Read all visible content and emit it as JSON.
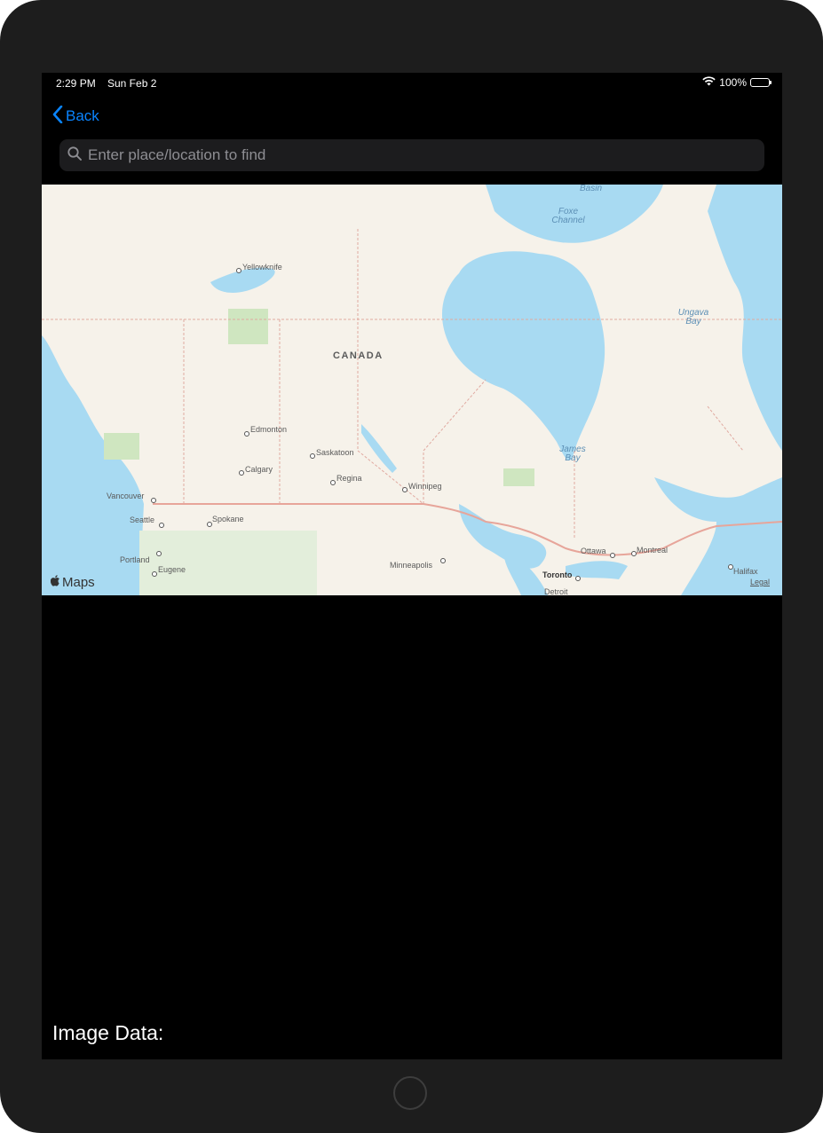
{
  "status_bar": {
    "time": "2:29 PM",
    "date": "Sun Feb 2",
    "battery": "100%",
    "battery_level": 1.0
  },
  "nav": {
    "back_label": "Back"
  },
  "search": {
    "placeholder": "Enter place/location to find",
    "value": ""
  },
  "map": {
    "country_label": "CANADA",
    "water_labels": {
      "basin": "Basin",
      "foxe_channel": "Foxe Channel",
      "ungava_bay": "Ungava Bay",
      "james_bay": "James Bay"
    },
    "cities": {
      "yellowknife": "Yellowknife",
      "edmonton": "Edmonton",
      "saskatoon": "Saskatoon",
      "calgary": "Calgary",
      "regina": "Regina",
      "winnipeg": "Winnipeg",
      "vancouver": "Vancouver",
      "seattle": "Seattle",
      "spokane": "Spokane",
      "portland": "Portland",
      "eugene": "Eugene",
      "minneapolis": "Minneapolis",
      "toronto": "Toronto",
      "detroit": "Detroit",
      "ottawa": "Ottawa",
      "montreal": "Montreal",
      "halifax": "Halifax"
    },
    "attribution": "Maps",
    "legal": "Legal"
  },
  "content": {
    "image_data_label": "Image Data:"
  },
  "colors": {
    "accent": "#0a84ff",
    "map_land": "#f6f2ea",
    "map_water": "#a8daf2",
    "map_park": "#cfe6c0"
  }
}
